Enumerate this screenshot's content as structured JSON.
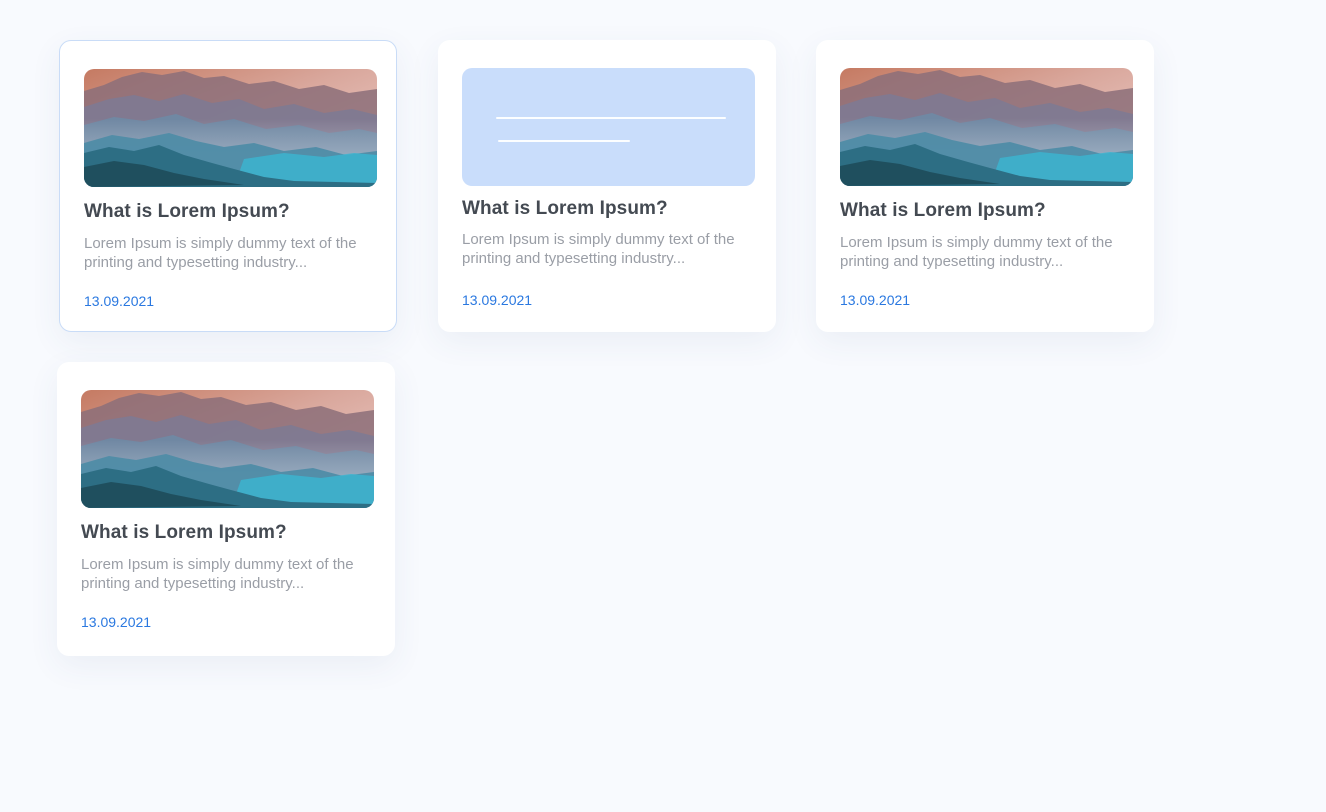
{
  "cards": [
    {
      "title": "What is Lorem Ipsum?",
      "excerpt": "Lorem Ipsum is simply dummy text of the printing and  typesetting industry...",
      "date": "13.09.2021",
      "image": "mountain-landscape",
      "selected": true
    },
    {
      "title": "What is Lorem Ipsum?",
      "excerpt": "Lorem Ipsum is simply dummy text of the printing and  typesetting industry...",
      "date": "13.09.2021",
      "image": "image-placeholder",
      "selected": false
    },
    {
      "title": "What is Lorem Ipsum?",
      "excerpt": "Lorem Ipsum is simply dummy text of the printing and  typesetting industry...",
      "date": "13.09.2021",
      "image": "mountain-landscape",
      "selected": false
    },
    {
      "title": "What is Lorem Ipsum?",
      "excerpt": "Lorem Ipsum is simply dummy text of the printing and  typesetting industry...",
      "date": "13.09.2021",
      "image": "mountain-landscape",
      "selected": false
    }
  ],
  "colors": {
    "background": "#f8fafe",
    "card": "#ffffff",
    "selected_border": "#c9dcf7",
    "title": "#444a52",
    "excerpt": "#9a9ea6",
    "date": "#2a78e0",
    "placeholder": "#c9ddfb"
  }
}
